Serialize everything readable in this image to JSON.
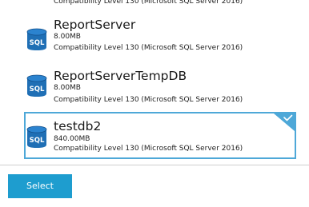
{
  "databases": [
    {
      "name": "",
      "size": "",
      "compatibility": "Compatibility Level 130 (Microsoft SQL Server 2016)",
      "icon": "sql-database-icon",
      "selected": false
    },
    {
      "name": "ReportServer",
      "size": "8.00MB",
      "compatibility": "Compatibility Level 130 (Microsoft SQL Server 2016)",
      "icon": "sql-database-icon",
      "selected": false
    },
    {
      "name": "ReportServerTempDB",
      "size": "8.00MB",
      "compatibility": "Compatibility Level 130 (Microsoft SQL Server 2016)",
      "icon": "sql-database-icon",
      "selected": false
    },
    {
      "name": "testdb2",
      "size": "840.00MB",
      "compatibility": "Compatibility Level 130 (Microsoft SQL Server 2016)",
      "icon": "sql-database-icon",
      "selected": true
    }
  ],
  "icon_label": "SQL",
  "footer": {
    "select_label": "Select"
  },
  "colors": {
    "accent": "#1e9dcf",
    "selected_border": "#4ea8d8",
    "icon_blue": "#1f6fb5",
    "icon_dark": "#134f8a"
  }
}
